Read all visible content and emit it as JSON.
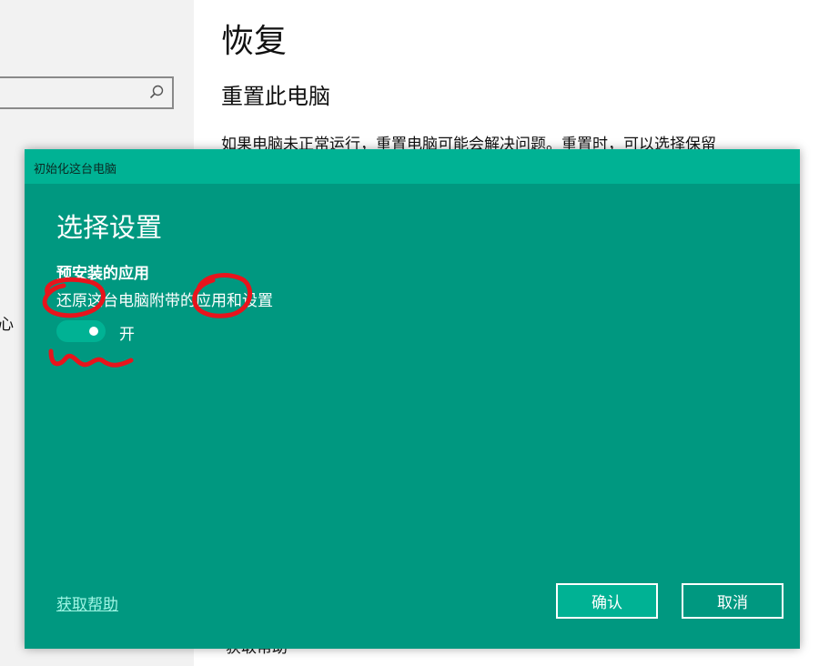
{
  "background": {
    "page_title": "恢复",
    "section_title": "重置此电脑",
    "section_desc": "如果电脑未正常运行，重置电脑可能会解决问题。重置时，可以选择保留",
    "left_nav_fragment": "心",
    "bottom_fragment": "获取帮助"
  },
  "dialog": {
    "title": "初始化这台电脑",
    "heading": "选择设置",
    "setting": {
      "name": "预安装的应用",
      "description": "还原这台电脑附带的应用和设置",
      "toggle_on": true,
      "toggle_state_label": "开"
    },
    "help_link": "获取帮助",
    "confirm_label": "确认",
    "cancel_label": "取消"
  },
  "colors": {
    "dialog_body": "#009880",
    "dialog_titlebar": "#00b294",
    "annotation": "#e8141c"
  },
  "icons": {
    "search": "search-icon"
  }
}
